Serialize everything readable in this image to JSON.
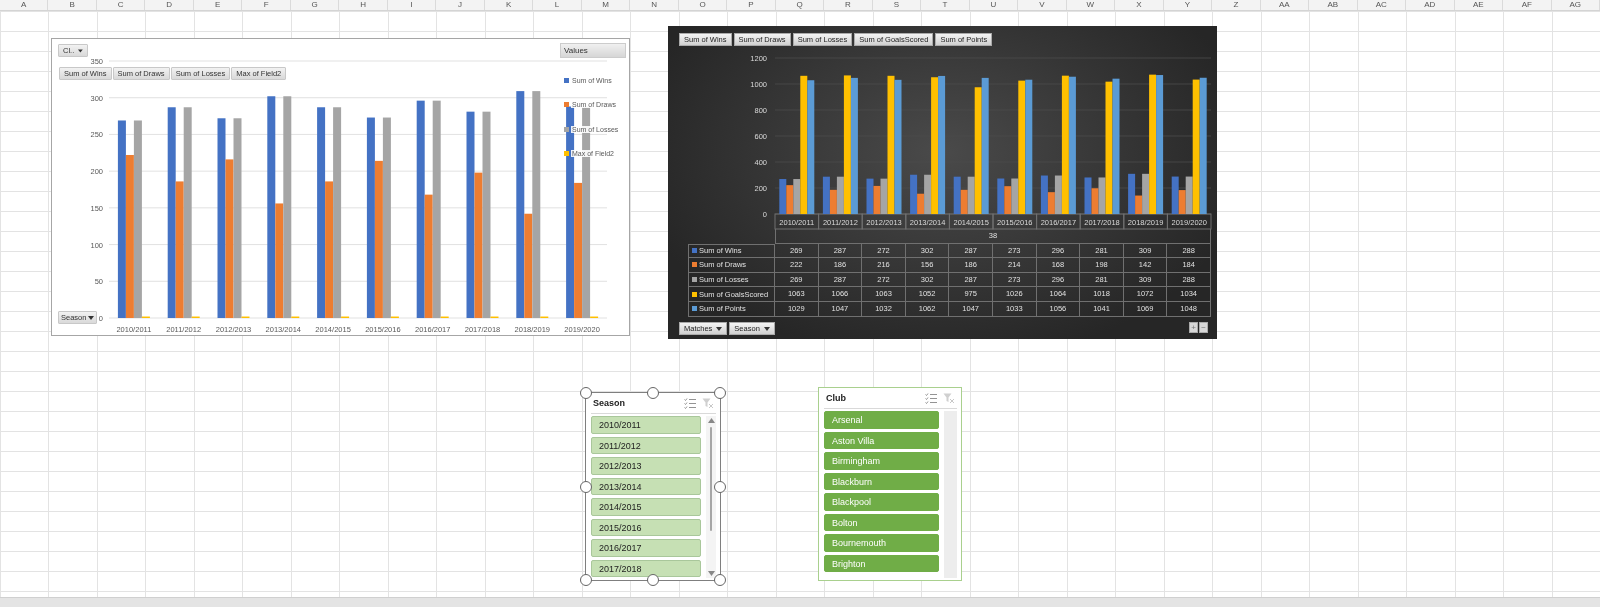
{
  "sheet": {
    "columns": [
      "A",
      "B",
      "C",
      "D",
      "E",
      "F",
      "G",
      "H",
      "I",
      "J",
      "K",
      "L",
      "M",
      "N",
      "O",
      "P",
      "Q",
      "R",
      "S",
      "T",
      "U",
      "V",
      "W",
      "X",
      "Y",
      "Z",
      "AA",
      "AB",
      "AC",
      "AD",
      "AE",
      "AF",
      "AG"
    ]
  },
  "left_chart": {
    "filter_buttons": [
      "Cl.."
    ],
    "value_buttons": [
      "Sum of Wins",
      "Sum of Draws",
      "Sum of Losses",
      "Max of Field2"
    ],
    "axis_buttons": [
      "Season"
    ],
    "legend_title": "Values",
    "chart_data": {
      "type": "bar",
      "grid": true,
      "categories": [
        "2010/2011",
        "2011/2012",
        "2012/2013",
        "2013/2014",
        "2014/2015",
        "2015/2016",
        "2016/2017",
        "2017/2018",
        "2018/2019",
        "2019/2020"
      ],
      "ylim": [
        0,
        350
      ],
      "yticks": [
        0,
        50,
        100,
        150,
        200,
        250,
        300,
        350
      ],
      "series": [
        {
          "name": "Sum of Wins",
          "color": "#4472c4",
          "values": [
            269,
            287,
            272,
            302,
            287,
            273,
            296,
            281,
            309,
            288
          ]
        },
        {
          "name": "Sum of Draws",
          "color": "#ed7d31",
          "values": [
            222,
            186,
            216,
            156,
            186,
            214,
            168,
            198,
            142,
            184
          ]
        },
        {
          "name": "Sum of Losses",
          "color": "#a5a5a5",
          "values": [
            269,
            287,
            272,
            302,
            287,
            273,
            296,
            281,
            309,
            288
          ]
        },
        {
          "name": "Max of Field2",
          "color": "#ffc000",
          "values": [
            2,
            2,
            2,
            2,
            2,
            2,
            2,
            2,
            2,
            2
          ]
        }
      ]
    }
  },
  "right_chart": {
    "value_buttons": [
      "Sum of Wins",
      "Sum of Draws",
      "Sum of Losses",
      "Sum of GoalsScored",
      "Sum of Points"
    ],
    "axis_buttons": [
      "Matches",
      "Season"
    ],
    "subcategory": "38",
    "zoom_buttons": [
      "+",
      "−"
    ],
    "data_table": [
      {
        "cells": [
          "269",
          "287",
          "272",
          "302",
          "287",
          "273",
          "296",
          "281",
          "309",
          "288"
        ]
      },
      {
        "cells": [
          "222",
          "186",
          "216",
          "156",
          "186",
          "214",
          "168",
          "198",
          "142",
          "184"
        ]
      },
      {
        "cells": [
          "269",
          "287",
          "272",
          "302",
          "287",
          "273",
          "296",
          "281",
          "309",
          "288"
        ]
      },
      {
        "cells": [
          "1063",
          "1066",
          "1063",
          "1052",
          "975",
          "1026",
          "1064",
          "1018",
          "1072",
          "1034"
        ]
      },
      {
        "cells": [
          "1029",
          "1047",
          "1032",
          "1062",
          "1047",
          "1033",
          "1056",
          "1041",
          "1069",
          "1048"
        ]
      }
    ],
    "chart_data": {
      "type": "bar",
      "grid": true,
      "categories": [
        "2010/2011",
        "2011/2012",
        "2012/2013",
        "2013/2014",
        "2014/2015",
        "2015/2016",
        "2016/2017",
        "2017/2018",
        "2018/2019",
        "2019/2020"
      ],
      "ylim": [
        0,
        1200
      ],
      "yticks": [
        0,
        200,
        400,
        600,
        800,
        1000,
        1200
      ],
      "series": [
        {
          "name": "Sum of Wins",
          "color": "#4472c4",
          "values": [
            269,
            287,
            272,
            302,
            287,
            273,
            296,
            281,
            309,
            288
          ]
        },
        {
          "name": "Sum of Draws",
          "color": "#ed7d31",
          "values": [
            222,
            186,
            216,
            156,
            186,
            214,
            168,
            198,
            142,
            184
          ]
        },
        {
          "name": "Sum of Losses",
          "color": "#a5a5a5",
          "values": [
            269,
            287,
            272,
            302,
            287,
            273,
            296,
            281,
            309,
            288
          ]
        },
        {
          "name": "Sum of GoalsScored",
          "color": "#ffc000",
          "values": [
            1063,
            1066,
            1063,
            1052,
            975,
            1026,
            1064,
            1018,
            1072,
            1034
          ]
        },
        {
          "name": "Sum of Points",
          "color": "#5b9bd5",
          "values": [
            1029,
            1047,
            1032,
            1062,
            1047,
            1033,
            1056,
            1041,
            1069,
            1048
          ]
        }
      ]
    }
  },
  "slicers": [
    {
      "title": "Season",
      "kind": "light",
      "handles": true,
      "scroll_arrows": true,
      "items": [
        {
          "label": "2010/2011",
          "selected": true
        },
        {
          "label": "2011/2012",
          "selected": true
        },
        {
          "label": "2012/2013",
          "selected": true
        },
        {
          "label": "2013/2014",
          "selected": true
        },
        {
          "label": "2014/2015",
          "selected": true
        },
        {
          "label": "2015/2016",
          "selected": true
        },
        {
          "label": "2016/2017",
          "selected": true
        },
        {
          "label": "2017/2018",
          "selected": true
        }
      ]
    },
    {
      "title": "Club",
      "kind": "dark",
      "handles": false,
      "scroll_arrows": false,
      "items": [
        {
          "label": "Arsenal",
          "selected": true
        },
        {
          "label": "Aston Villa",
          "selected": true
        },
        {
          "label": "Birmingham",
          "selected": true
        },
        {
          "label": "Blackburn",
          "selected": true
        },
        {
          "label": "Blackpool",
          "selected": true
        },
        {
          "label": "Bolton",
          "selected": true
        },
        {
          "label": "Bournemouth",
          "selected": true
        },
        {
          "label": "Brighton",
          "selected": true
        }
      ]
    }
  ]
}
